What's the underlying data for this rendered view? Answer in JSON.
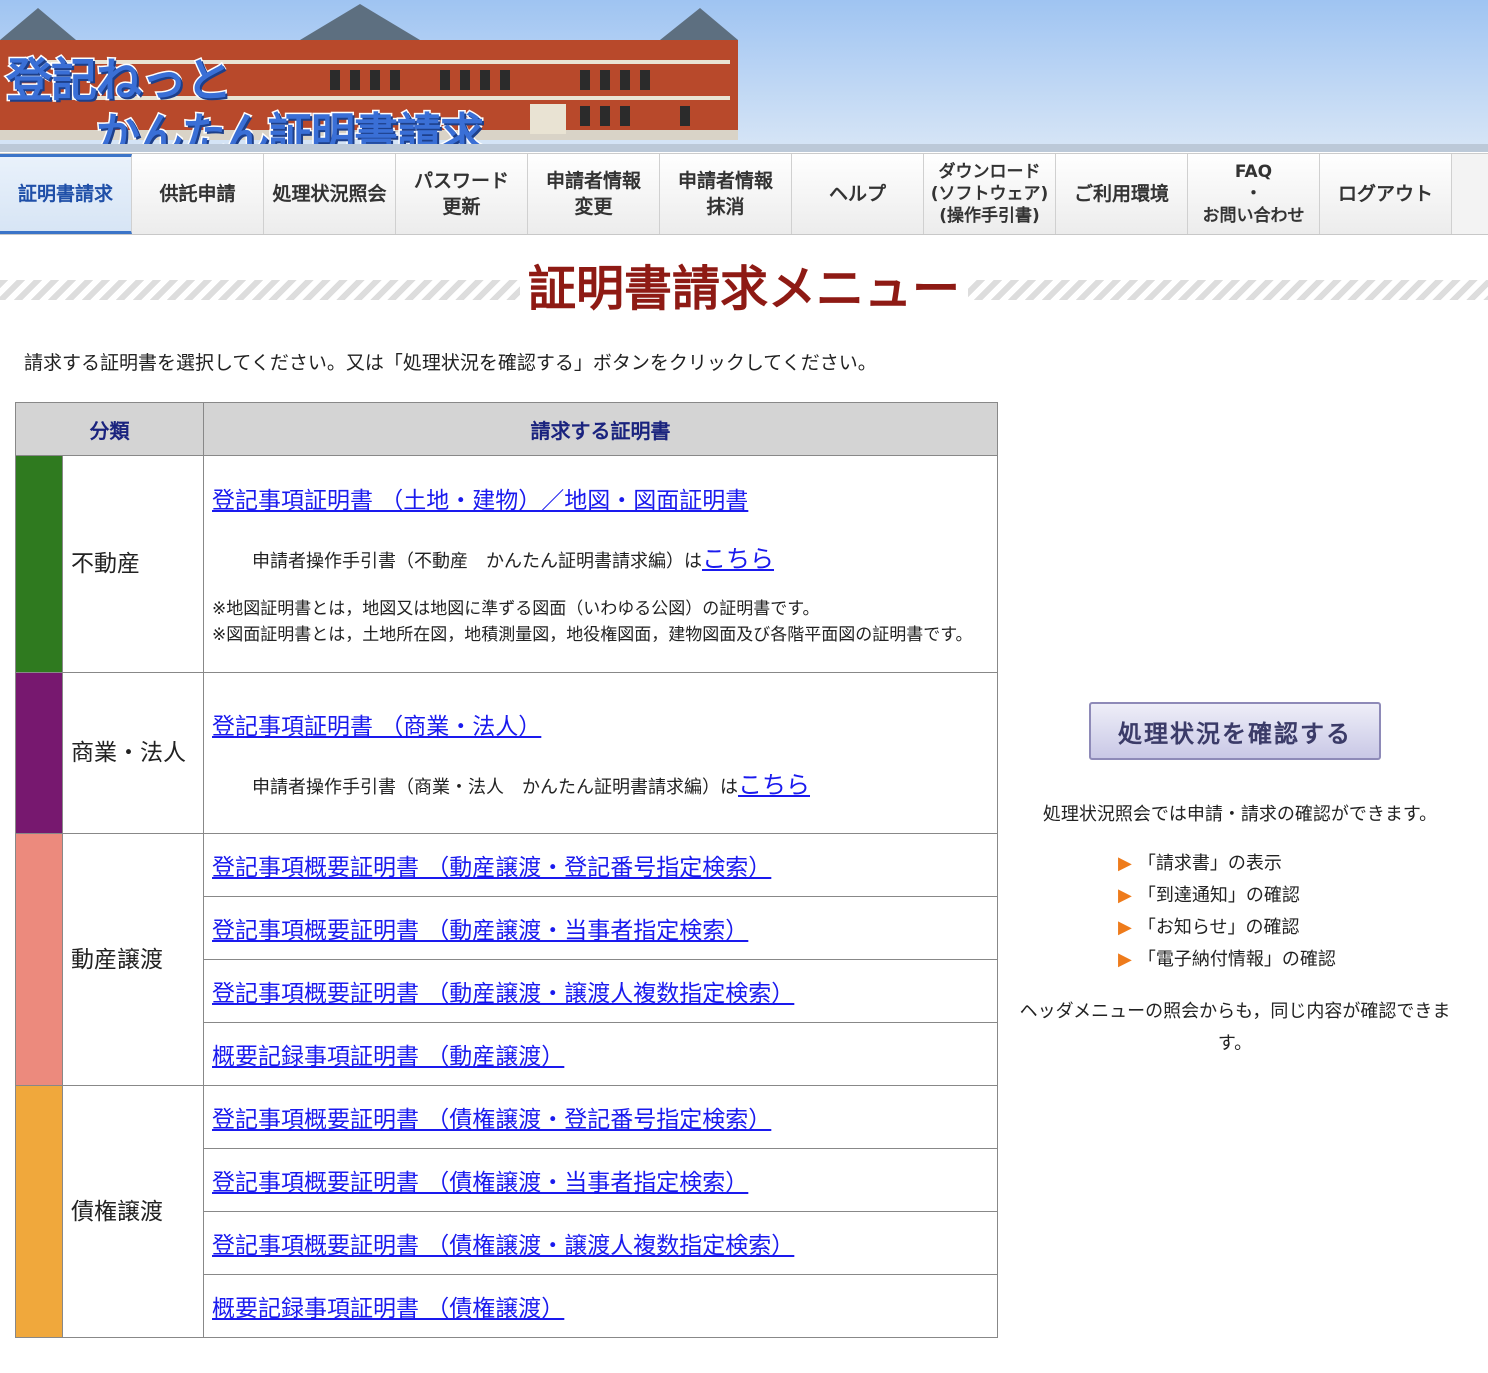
{
  "header": {
    "logo_line1": "登記ねっと",
    "logo_line2": "かんたん証明書請求"
  },
  "nav": [
    {
      "label": "証明書請求",
      "active": true
    },
    {
      "label": "供託申請"
    },
    {
      "label": "処理状況照会"
    },
    {
      "label": "パスワード\n更新"
    },
    {
      "label": "申請者情報\n変更"
    },
    {
      "label": "申請者情報\n抹消"
    },
    {
      "label": "ヘルプ"
    },
    {
      "label": "ダウンロード\n(ソフトウェア)\n(操作手引書)"
    },
    {
      "label": "ご利用環境"
    },
    {
      "label": "FAQ\n・\nお問い合わせ"
    },
    {
      "label": "ログアウト"
    }
  ],
  "page_title": "証明書請求メニュー",
  "intro": "請求する証明書を選択してください。又は「処理状況を確認する」ボタンをクリックしてください。",
  "table": {
    "col_category": "分類",
    "col_certificate": "請求する証明書",
    "real_estate": {
      "category": "不動産",
      "color": "#2f7a1f",
      "link": "登記事項証明書 （土地・建物）／地図・図面証明書",
      "guide_text": "申請者操作手引書（不動産　かんたん証明書請求編）は",
      "guide_link": "こちら",
      "note1": "※地図証明書とは，地図又は地図に準ずる図面（いわゆる公図）の証明書です。",
      "note2": "※図面証明書とは，土地所在図，地積測量図，地役権図面，建物図面及び各階平面図の証明書です。"
    },
    "commercial": {
      "category": "商業・法人",
      "color": "#77186f",
      "link": "登記事項証明書 （商業・法人）",
      "guide_text": "申請者操作手引書（商業・法人　かんたん証明書請求編）は",
      "guide_link": "こちら"
    },
    "movables": {
      "category": "動産譲渡",
      "color": "#ec8a7d",
      "links": [
        "登記事項概要証明書 （動産譲渡・登記番号指定検索）",
        "登記事項概要証明書 （動産譲渡・当事者指定検索）",
        "登記事項概要証明書 （動産譲渡・譲渡人複数指定検索）",
        "概要記録事項証明書 （動産譲渡）"
      ]
    },
    "claims": {
      "category": "債権譲渡",
      "color": "#f0a83c",
      "links": [
        "登記事項概要証明書 （債権譲渡・登記番号指定検索）",
        "登記事項概要証明書 （債権譲渡・当事者指定検索）",
        "登記事項概要証明書 （債権譲渡・譲渡人複数指定検索）",
        "概要記録事項証明書 （債権譲渡）"
      ]
    }
  },
  "status": {
    "button": "処理状況を確認する",
    "description": "処理状況照会では申請・請求の確認ができます。",
    "items": [
      "「請求書」の表示",
      "「到達通知」の確認",
      "「お知らせ」の確認",
      "「電子納付情報」の確認"
    ],
    "header_note": "ヘッダメニューの照会からも，同じ内容が確認できます。"
  }
}
